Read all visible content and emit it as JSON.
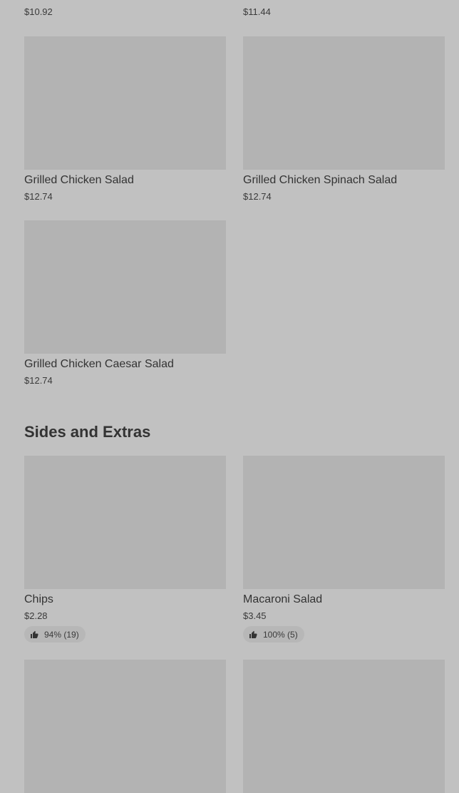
{
  "top_row": {
    "left_price": "$10.92",
    "right_price": "$11.44"
  },
  "salads": [
    {
      "name": "Grilled Chicken Salad",
      "price": "$12.74"
    },
    {
      "name": "Grilled Chicken Spinach Salad",
      "price": "$12.74"
    },
    {
      "name": "Grilled Chicken Caesar Salad",
      "price": "$12.74"
    }
  ],
  "sides_section": {
    "title": "Sides and Extras",
    "items": [
      {
        "name": "Chips",
        "price": "$2.28",
        "rating": "94% (19)"
      },
      {
        "name": "Macaroni Salad",
        "price": "$3.45",
        "rating": "100% (5)"
      }
    ]
  },
  "icons": {
    "thumbs_up": "thumbs-up-icon"
  }
}
